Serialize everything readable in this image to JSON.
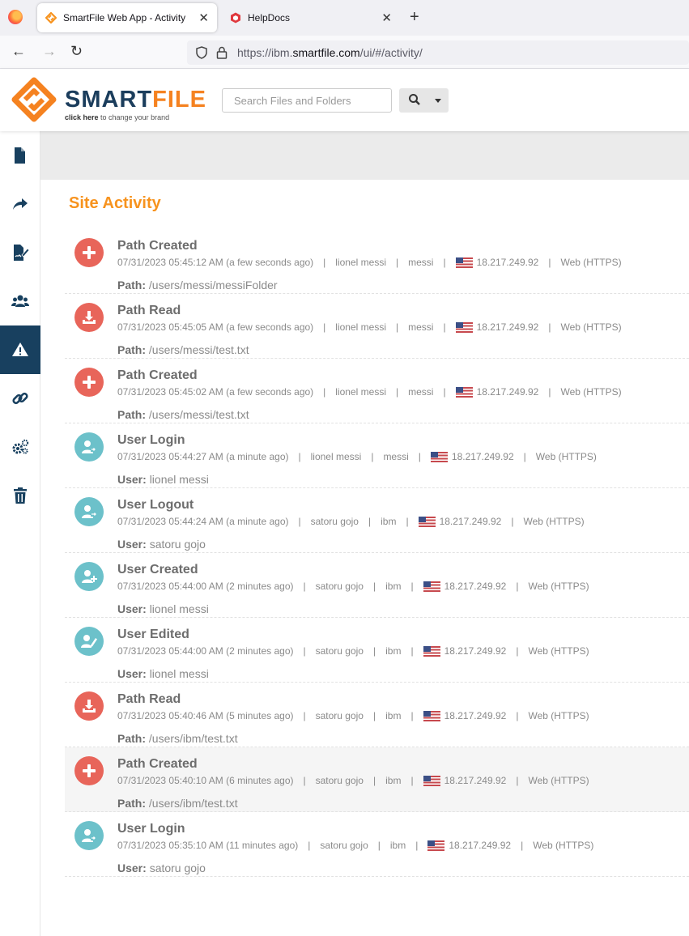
{
  "browser": {
    "tabs": [
      {
        "title": "SmartFile Web App - Activity",
        "active": true
      },
      {
        "title": "HelpDocs",
        "active": false
      }
    ],
    "url_prefix": "https://ibm.",
    "url_domain": "smartfile.com",
    "url_path": "/ui/#/activity/"
  },
  "header": {
    "logo_main": "SMART",
    "logo_accent": "FILE",
    "logo_sub_bold": "click here",
    "logo_sub_rest": " to change your brand",
    "search_placeholder": "Search Files and Folders"
  },
  "sidebar": {
    "items": [
      {
        "icon": "file-icon",
        "active": false
      },
      {
        "icon": "share-icon",
        "active": false
      },
      {
        "icon": "sign-document-icon",
        "active": false
      },
      {
        "icon": "users-icon",
        "active": false
      },
      {
        "icon": "warning-icon",
        "active": true
      },
      {
        "icon": "link-icon",
        "active": false
      },
      {
        "icon": "settings-icon",
        "active": false
      },
      {
        "icon": "trash-icon",
        "active": false
      }
    ]
  },
  "main": {
    "title": "Site Activity",
    "activities": [
      {
        "type": "Path Created",
        "icon": "plus-icon",
        "color": "red",
        "datetime": "07/31/2023 05:45:12 AM (a few seconds ago)",
        "user": "lionel messi",
        "account": "messi",
        "ip": "18.217.249.92",
        "method": "Web (HTTPS)",
        "detail_label": "Path:",
        "detail_value": "/users/messi/messiFolder"
      },
      {
        "type": "Path Read",
        "icon": "download-icon",
        "color": "red",
        "datetime": "07/31/2023 05:45:05 AM (a few seconds ago)",
        "user": "lionel messi",
        "account": "messi",
        "ip": "18.217.249.92",
        "method": "Web (HTTPS)",
        "detail_label": "Path:",
        "detail_value": "/users/messi/test.txt"
      },
      {
        "type": "Path Created",
        "icon": "plus-icon",
        "color": "red",
        "datetime": "07/31/2023 05:45:02 AM (a few seconds ago)",
        "user": "lionel messi",
        "account": "messi",
        "ip": "18.217.249.92",
        "method": "Web (HTTPS)",
        "detail_label": "Path:",
        "detail_value": "/users/messi/test.txt"
      },
      {
        "type": "User Login",
        "icon": "user-login-icon",
        "color": "teal",
        "datetime": "07/31/2023 05:44:27 AM (a minute ago)",
        "user": "lionel messi",
        "account": "messi",
        "ip": "18.217.249.92",
        "method": "Web (HTTPS)",
        "detail_label": "User:",
        "detail_value": "lionel messi"
      },
      {
        "type": "User Logout",
        "icon": "user-logout-icon",
        "color": "teal",
        "datetime": "07/31/2023 05:44:24 AM (a minute ago)",
        "user": "satoru gojo",
        "account": "ibm",
        "ip": "18.217.249.92",
        "method": "Web (HTTPS)",
        "detail_label": "User:",
        "detail_value": "satoru gojo"
      },
      {
        "type": "User Created",
        "icon": "user-add-icon",
        "color": "teal",
        "datetime": "07/31/2023 05:44:00 AM (2 minutes ago)",
        "user": "satoru gojo",
        "account": "ibm",
        "ip": "18.217.249.92",
        "method": "Web (HTTPS)",
        "detail_label": "User:",
        "detail_value": "lionel messi"
      },
      {
        "type": "User Edited",
        "icon": "user-edit-icon",
        "color": "teal",
        "datetime": "07/31/2023 05:44:00 AM (2 minutes ago)",
        "user": "satoru gojo",
        "account": "ibm",
        "ip": "18.217.249.92",
        "method": "Web (HTTPS)",
        "detail_label": "User:",
        "detail_value": "lionel messi"
      },
      {
        "type": "Path Read",
        "icon": "download-icon",
        "color": "red",
        "datetime": "07/31/2023 05:40:46 AM (5 minutes ago)",
        "user": "satoru gojo",
        "account": "ibm",
        "ip": "18.217.249.92",
        "method": "Web (HTTPS)",
        "detail_label": "Path:",
        "detail_value": "/users/ibm/test.txt"
      },
      {
        "type": "Path Created",
        "icon": "plus-icon",
        "color": "red",
        "datetime": "07/31/2023 05:40:10 AM (6 minutes ago)",
        "user": "satoru gojo",
        "account": "ibm",
        "ip": "18.217.249.92",
        "method": "Web (HTTPS)",
        "detail_label": "Path:",
        "detail_value": "/users/ibm/test.txt"
      },
      {
        "type": "User Login",
        "icon": "user-login-icon",
        "color": "teal",
        "datetime": "07/31/2023 05:35:10 AM (11 minutes ago)",
        "user": "satoru gojo",
        "account": "ibm",
        "ip": "18.217.249.92",
        "method": "Web (HTTPS)",
        "detail_label": "User:",
        "detail_value": "satoru gojo"
      }
    ]
  },
  "colors": {
    "accent": "#f7931e",
    "sidebar_active": "#18405f",
    "red_icon": "#e8655a",
    "teal_icon": "#6cc1ca"
  }
}
